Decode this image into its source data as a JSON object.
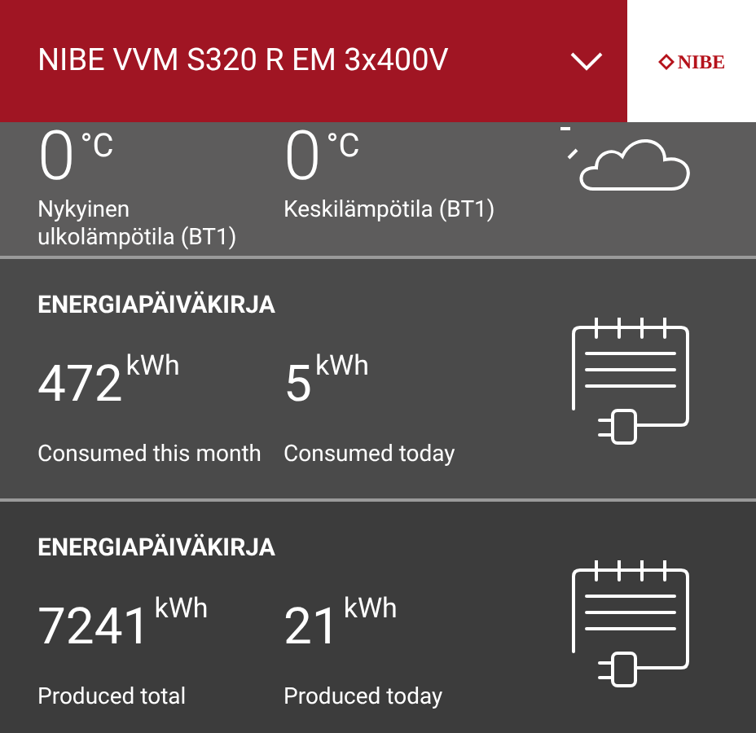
{
  "header": {
    "title": "NIBE VVM S320 R EM 3x400V",
    "logo": "NIBE"
  },
  "sections": [
    {
      "kind": "weather",
      "items": [
        {
          "value": "0",
          "unit": "°C",
          "label": "Nykyinen ulkolämpötila (BT1)"
        },
        {
          "value": "0",
          "unit": "°C",
          "label": "Keskilämpötila (BT1)"
        }
      ]
    },
    {
      "title": "ENERGIAPÄIVÄKIRJA",
      "kind": "log",
      "items": [
        {
          "value": "472",
          "unit": "kWh",
          "label": "Consumed this month"
        },
        {
          "value": "5",
          "unit": "kWh",
          "label": "Consumed today"
        }
      ]
    },
    {
      "title": "ENERGIAPÄIVÄKIRJA",
      "kind": "log",
      "items": [
        {
          "value": "7241",
          "unit": "kWh",
          "label": "Produced total"
        },
        {
          "value": "21",
          "unit": "kWh",
          "label": "Produced today"
        }
      ]
    }
  ]
}
